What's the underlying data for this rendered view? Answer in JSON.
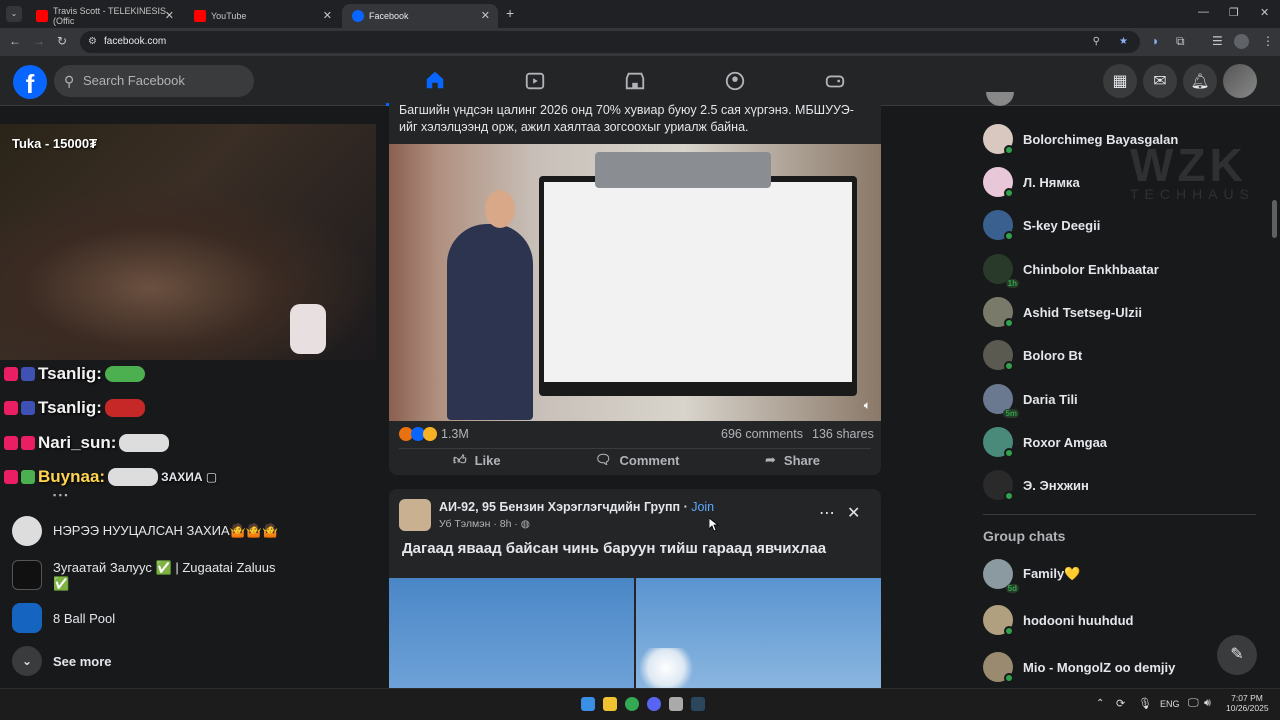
{
  "browser": {
    "tabs": [
      {
        "title": "Travis Scott - TELEKINESIS (Offic",
        "active": false
      },
      {
        "title": "YouTube",
        "active": false
      },
      {
        "title": "Facebook",
        "active": true
      }
    ],
    "url": "facebook.com"
  },
  "header": {
    "logo": "f",
    "search_placeholder": "Search Facebook"
  },
  "stream_overlay": {
    "top_text": "Tuka - 15000₮",
    "watermark_main": "WZK",
    "watermark_sub": "TECHHAUS"
  },
  "chat_lines": [
    {
      "name": "Tsanlig:"
    },
    {
      "name": "Tsanlig:"
    },
    {
      "name": "Nari_sun:"
    },
    {
      "name": "Buynaa:"
    }
  ],
  "left_shortcuts": [
    {
      "label": "ЗАХИА ▢",
      "sub": "▪ ▪ ▪"
    },
    {
      "label": "НЭРЭЭ НУУЦАЛСАН ЗАХИА🤷🤷🤷"
    },
    {
      "label": "Зугаатай Залуус ✅ | Zugaatai Zaluus",
      "sub": "✅"
    },
    {
      "label": "8 Ball Pool"
    },
    {
      "label": "See more"
    }
  ],
  "post1": {
    "text": "Багшийн үндсэн цалинг 2026 онд  70% хувиар буюу 2.5 сая хүргэнэ. МБШУУЭ-ийг хэлэлцээнд орж, ажил хаялтаа зогсоохыг уриалж байна.",
    "reactions": "1.3M",
    "comments": "696 comments",
    "shares": "136 shares",
    "actions": {
      "like": "Like",
      "comment": "Comment",
      "share": "Share"
    }
  },
  "post2": {
    "author": "АИ-92, 95 Бензин Хэрэглэгчдийн Групп",
    "join": "Join",
    "meta": "Уб Тэлмэн · 8h ·",
    "text": "Дагаад яваад байсан чинь баруун тийш гараад явчихлаа"
  },
  "contacts": [
    {
      "name": "Bolorchimeg Bayasgalan",
      "status": ""
    },
    {
      "name": "Л. Нямка",
      "status": ""
    },
    {
      "name": "S-key Deegii",
      "status": ""
    },
    {
      "name": "Chinbolor Enkhbaatar",
      "status": "1h"
    },
    {
      "name": "Ashid Tsetseg-Ulzii",
      "status": ""
    },
    {
      "name": "Boloro Bt",
      "status": ""
    },
    {
      "name": "Daria Tili",
      "status": "5m"
    },
    {
      "name": "Roxor Amgaa",
      "status": ""
    },
    {
      "name": "Э. Энхжин",
      "status": ""
    }
  ],
  "group_chats": {
    "heading": "Group chats",
    "items": [
      {
        "name": "Family💛",
        "status": "5d"
      },
      {
        "name": "hodooni huuhdud",
        "status": ""
      },
      {
        "name": "Mio - MongolZ oo demjiy",
        "status": ""
      }
    ]
  },
  "taskbar": {
    "lang": "ENG",
    "time": "7:07 PM",
    "date": "10/26/2025"
  },
  "colors": {
    "fb_blue": "#0866ff",
    "online": "#31a24c",
    "bg": "#18191a",
    "card": "#242526"
  }
}
